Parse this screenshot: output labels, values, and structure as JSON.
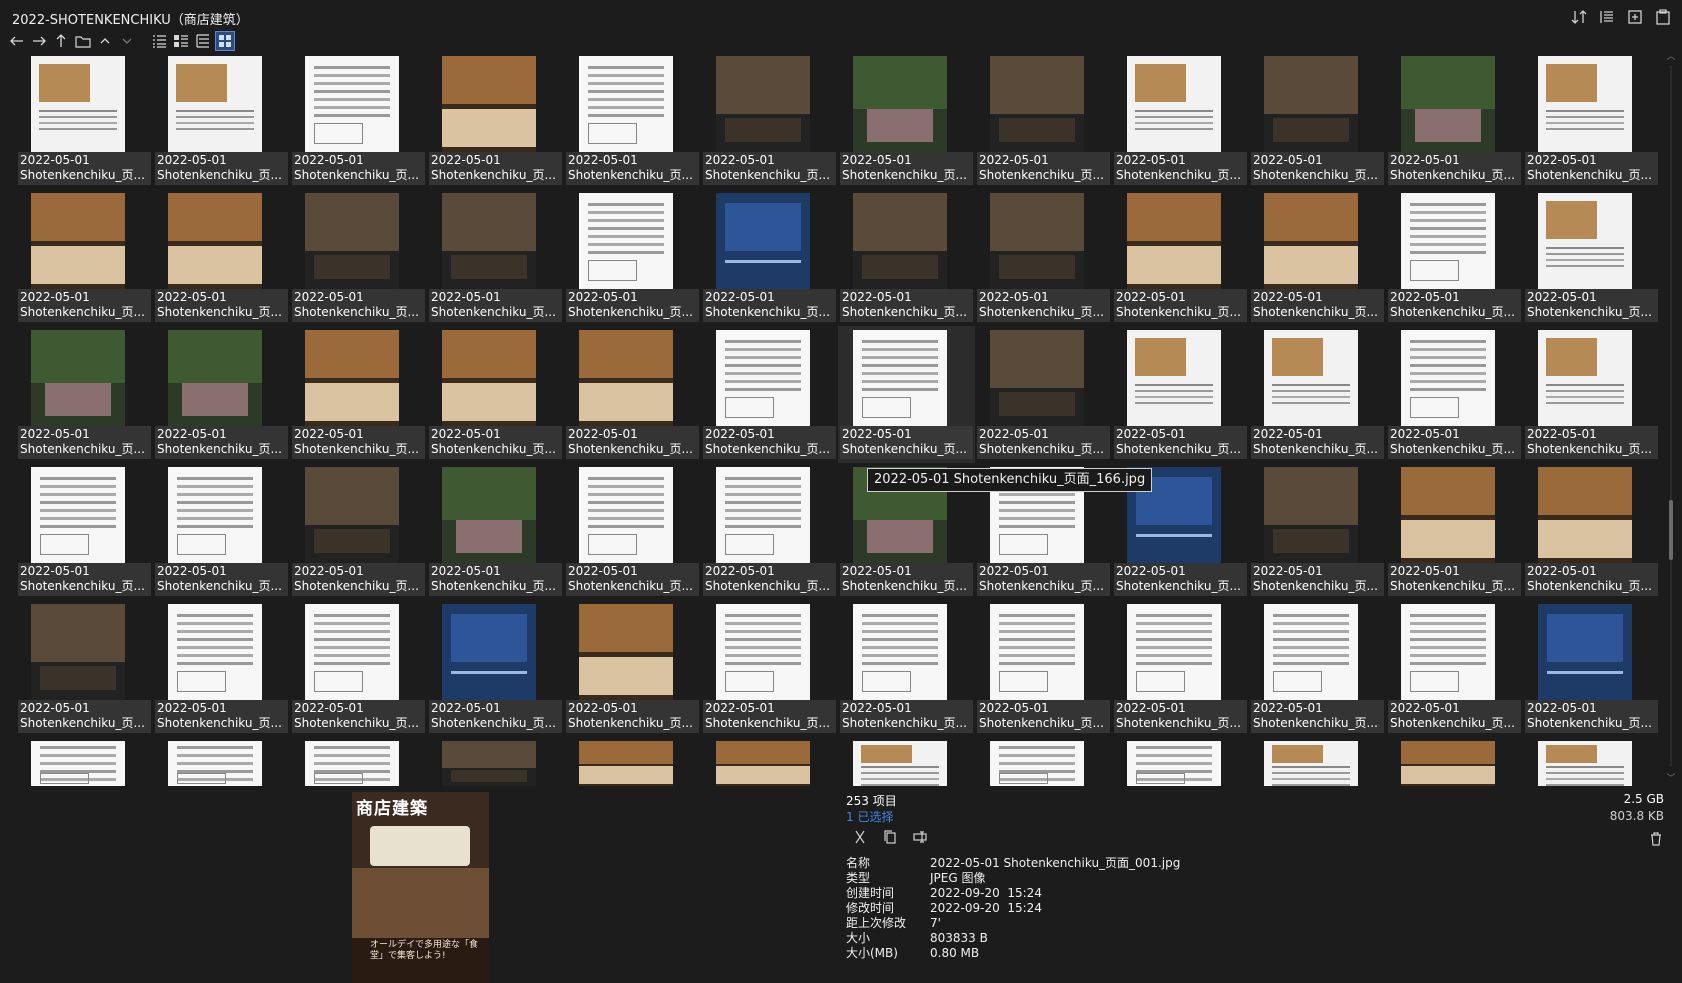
{
  "window": {
    "title": "2022-SHOTENKENCHIKU（商店建筑）"
  },
  "toolbar": {
    "nav": [
      "back-icon",
      "forward-icon",
      "up-icon",
      "folder-icon",
      "chevron-up-icon",
      "chevron-down-icon"
    ],
    "views": [
      "list-view-icon",
      "details-view-icon",
      "tree-view-icon",
      "thumbnail-view-icon"
    ],
    "active_view": "thumbnail-view-icon"
  },
  "top_right": [
    "sort-icon",
    "filter-icon",
    "new-window-icon",
    "paste-icon"
  ],
  "grid": {
    "date": "2022-05-01",
    "name": "Shotenkenchiku_页...",
    "rows": [
      [
        "light",
        "light",
        "doc",
        "wood",
        "doc",
        "dark",
        "green",
        "dark",
        "light",
        "dark",
        "green",
        "light"
      ],
      [
        "wood",
        "wood",
        "dark",
        "dark",
        "doc",
        "blue",
        "dark",
        "dark",
        "wood",
        "wood",
        "doc",
        "light"
      ],
      [
        "green",
        "green",
        "wood",
        "wood",
        "wood",
        "doc",
        "doc",
        "dark",
        "light",
        "light",
        "doc",
        "light"
      ],
      [
        "doc",
        "doc",
        "dark",
        "green",
        "doc",
        "doc",
        "green",
        "doc",
        "blue",
        "dark",
        "wood",
        "wood"
      ],
      [
        "dark",
        "doc",
        "doc",
        "blue",
        "wood",
        "doc",
        "doc",
        "doc",
        "doc",
        "doc",
        "doc",
        "blue"
      ],
      [
        "doc",
        "doc",
        "doc",
        "dark",
        "wood",
        "wood",
        "light",
        "doc",
        "doc",
        "light",
        "wood",
        "light"
      ]
    ],
    "hovered": {
      "row": 2,
      "col": 6
    },
    "tooltip": "2022-05-01 Shotenkenchiku_页面_166.jpg",
    "colors": {
      "background": "#1c1c1c",
      "label_bg": "#3c3c3c",
      "accent": "#3d86e0"
    }
  },
  "preview": {
    "title": "商店建築",
    "caption": "オールデイで多用途な「食堂」で集客しよう!"
  },
  "status": {
    "count": "253 项目",
    "selected": "1 已选择",
    "total_size": "2.5 GB",
    "selected_size": "803.8 KB"
  },
  "actions": [
    "cut-icon",
    "copy-icon",
    "rename-icon"
  ],
  "properties": [
    {
      "key": "名称",
      "value": "2022-05-01 Shotenkenchiku_页面_001.jpg"
    },
    {
      "key": "类型",
      "value": "JPEG 图像"
    },
    {
      "key": "创建时间",
      "value": "2022-09-20  15:24"
    },
    {
      "key": "修改时间",
      "value": "2022-09-20  15:24"
    },
    {
      "key": "距上次修改",
      "value": "7'"
    },
    {
      "key": "大小",
      "value": "803833 B"
    },
    {
      "key": "大小(MB)",
      "value": "0.80 MB"
    }
  ]
}
